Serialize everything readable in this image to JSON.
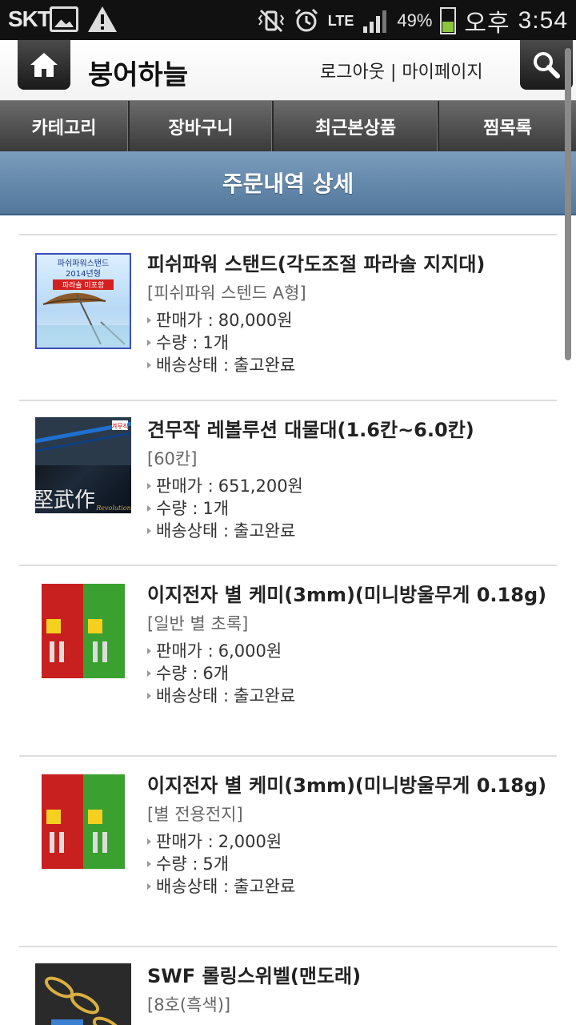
{
  "status_bar": {
    "carrier": "SKT",
    "battery_percent": "49%",
    "time_period": "오후",
    "time": "3:54",
    "network": "LTE"
  },
  "header": {
    "brand": "붕어하늘",
    "auth_links": "로그아웃 | 마이페이지"
  },
  "nav": {
    "items": [
      "카테고리",
      "장바구니",
      "최근본상품",
      "찜목록"
    ]
  },
  "page_title": "주문내역 상세",
  "labels": {
    "price": "판매가 :",
    "qty": "수량 :",
    "shipping": "배송상태 :"
  },
  "umbrella_thumb": {
    "line1": "파쉬파워스탠드",
    "line2": "2014년형",
    "line3": "파라솔 미포함"
  },
  "rod_thumb": {
    "brand_mark": "겨무작",
    "title": "堅武作",
    "sub": "Revolution"
  },
  "orders": [
    {
      "name": "피쉬파워 스탠드(각도조절 파라솔 지지대)",
      "option": "[피쉬파워 스텐드 A형]",
      "price": "80,000원",
      "qty": "1개",
      "status": "출고완료"
    },
    {
      "name": "견무작 레볼루션 대물대(1.6칸~6.0칸)",
      "option": "[60칸]",
      "price": "651,200원",
      "qty": "1개",
      "status": "출고완료"
    },
    {
      "name": "이지전자 별 케미(3mm)(미니방울무게 0.18g)",
      "option": "[일반 별 초록]",
      "price": "6,000원",
      "qty": "6개",
      "status": "출고완료"
    },
    {
      "name": "이지전자 별 케미(3mm)(미니방울무게 0.18g)",
      "option": "[별 전용전지]",
      "price": "2,000원",
      "qty": "5개",
      "status": "출고완료"
    },
    {
      "name": "SWF 롤링스위벨(맨도래)",
      "option": "[8호(흑색)]",
      "price": "",
      "qty": "",
      "status": ""
    }
  ]
}
